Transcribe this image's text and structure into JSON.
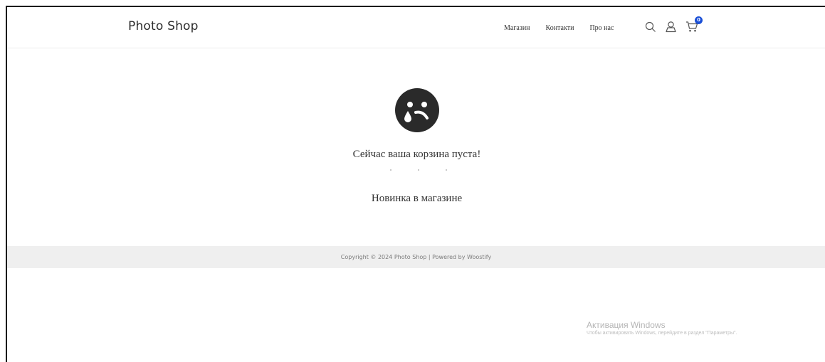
{
  "header": {
    "brand": "Photo Shop",
    "nav": [
      "Магазин",
      "Контакти",
      "Про нас"
    ],
    "icons": [
      "search-icon",
      "user-icon",
      "cart-icon"
    ],
    "cart_count": "0",
    "badge_color": "#1a4fd6"
  },
  "main": {
    "empty_icon": "sad-face-icon",
    "empty_message": "Сейчас ваша корзина пуста!",
    "shop_link": "Новинка в магазине"
  },
  "footer": {
    "copyright": "Copyright © 2024 Photo Shop | Powered by Woostify"
  },
  "watermark": {
    "title": "Активация Windows",
    "subtitle": "Чтобы активировать Windows, перейдите в раздел \"Параметры\"."
  }
}
